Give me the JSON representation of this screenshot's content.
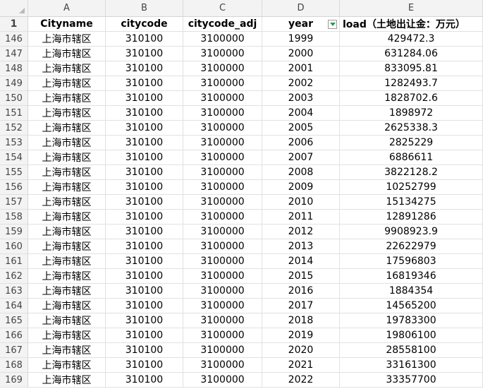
{
  "column_letters": [
    "A",
    "B",
    "C",
    "D",
    "E"
  ],
  "field_row": {
    "row_number": "1",
    "headers": [
      "Cityname",
      "citycode",
      "citycode_adj",
      "year",
      "load（土地出让金：万元）"
    ]
  },
  "rows": [
    {
      "n": "146",
      "city": "上海市辖区",
      "code": "310100",
      "adj": "3100000",
      "year": "1999",
      "load": "429472.3"
    },
    {
      "n": "147",
      "city": "上海市辖区",
      "code": "310100",
      "adj": "3100000",
      "year": "2000",
      "load": "631284.06"
    },
    {
      "n": "148",
      "city": "上海市辖区",
      "code": "310100",
      "adj": "3100000",
      "year": "2001",
      "load": "833095.81"
    },
    {
      "n": "149",
      "city": "上海市辖区",
      "code": "310100",
      "adj": "3100000",
      "year": "2002",
      "load": "1282493.7"
    },
    {
      "n": "150",
      "city": "上海市辖区",
      "code": "310100",
      "adj": "3100000",
      "year": "2003",
      "load": "1828702.6"
    },
    {
      "n": "151",
      "city": "上海市辖区",
      "code": "310100",
      "adj": "3100000",
      "year": "2004",
      "load": "1898972"
    },
    {
      "n": "152",
      "city": "上海市辖区",
      "code": "310100",
      "adj": "3100000",
      "year": "2005",
      "load": "2625338.3"
    },
    {
      "n": "153",
      "city": "上海市辖区",
      "code": "310100",
      "adj": "3100000",
      "year": "2006",
      "load": "2825229"
    },
    {
      "n": "154",
      "city": "上海市辖区",
      "code": "310100",
      "adj": "3100000",
      "year": "2007",
      "load": "6886611"
    },
    {
      "n": "155",
      "city": "上海市辖区",
      "code": "310100",
      "adj": "3100000",
      "year": "2008",
      "load": "3822128.2"
    },
    {
      "n": "156",
      "city": "上海市辖区",
      "code": "310100",
      "adj": "3100000",
      "year": "2009",
      "load": "10252799"
    },
    {
      "n": "157",
      "city": "上海市辖区",
      "code": "310100",
      "adj": "3100000",
      "year": "2010",
      "load": "15134275"
    },
    {
      "n": "158",
      "city": "上海市辖区",
      "code": "310100",
      "adj": "3100000",
      "year": "2011",
      "load": "12891286"
    },
    {
      "n": "159",
      "city": "上海市辖区",
      "code": "310100",
      "adj": "3100000",
      "year": "2012",
      "load": "9908923.9"
    },
    {
      "n": "160",
      "city": "上海市辖区",
      "code": "310100",
      "adj": "3100000",
      "year": "2013",
      "load": "22622979"
    },
    {
      "n": "161",
      "city": "上海市辖区",
      "code": "310100",
      "adj": "3100000",
      "year": "2014",
      "load": "17596803"
    },
    {
      "n": "162",
      "city": "上海市辖区",
      "code": "310100",
      "adj": "3100000",
      "year": "2015",
      "load": "16819346"
    },
    {
      "n": "163",
      "city": "上海市辖区",
      "code": "310100",
      "adj": "3100000",
      "year": "2016",
      "load": "1884354"
    },
    {
      "n": "164",
      "city": "上海市辖区",
      "code": "310100",
      "adj": "3100000",
      "year": "2017",
      "load": "14565200"
    },
    {
      "n": "165",
      "city": "上海市辖区",
      "code": "310100",
      "adj": "3100000",
      "year": "2018",
      "load": "19783300"
    },
    {
      "n": "166",
      "city": "上海市辖区",
      "code": "310100",
      "adj": "3100000",
      "year": "2019",
      "load": "19806100"
    },
    {
      "n": "167",
      "city": "上海市辖区",
      "code": "310100",
      "adj": "3100000",
      "year": "2020",
      "load": "28558100"
    },
    {
      "n": "168",
      "city": "上海市辖区",
      "code": "310100",
      "adj": "3100000",
      "year": "2021",
      "load": "33161300"
    },
    {
      "n": "169",
      "city": "上海市辖区",
      "code": "310100",
      "adj": "3100000",
      "year": "2022",
      "load": "33357700"
    }
  ],
  "icons": {
    "select_all": "select-all-corner-icon",
    "filter": "filter-dropdown-icon"
  },
  "colors": {
    "header_bg": "#f3f3f3",
    "grid_line": "#e1e1e1",
    "filter_arrow": "#1f9d55"
  }
}
